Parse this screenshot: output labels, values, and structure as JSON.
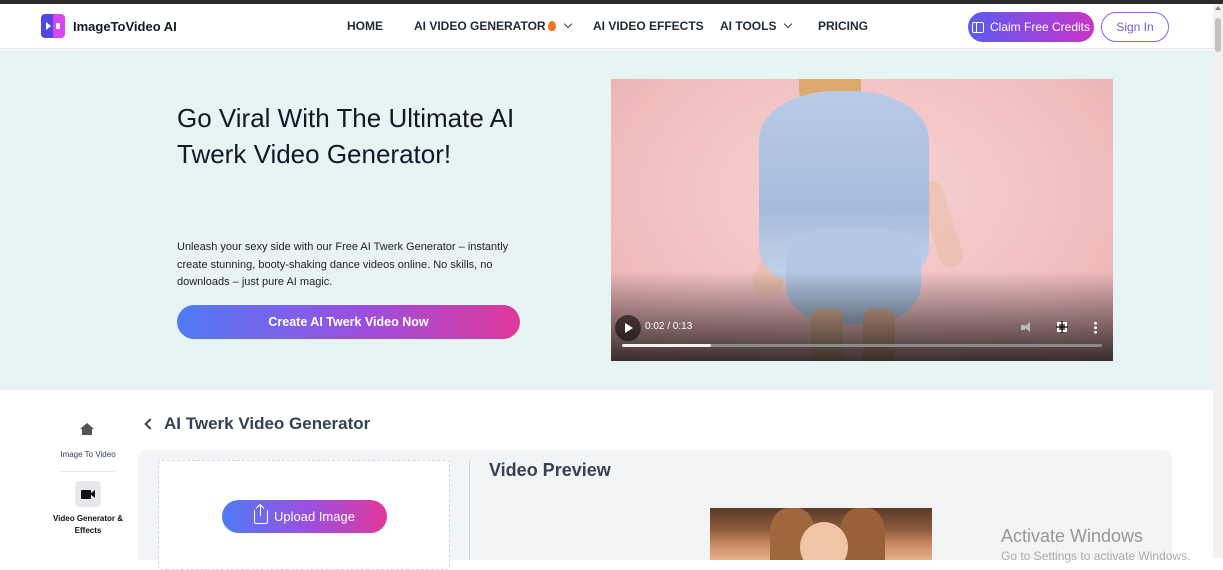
{
  "header": {
    "brand": "ImageToVideo AI",
    "nav": [
      {
        "label": "HOME"
      },
      {
        "label": "AI VIDEO GENERATOR"
      },
      {
        "label": "AI VIDEO EFFECTS"
      },
      {
        "label": "AI TOOLS"
      },
      {
        "label": "PRICING"
      }
    ],
    "claim_label": "Claim Free Credits",
    "signin_label": "Sign In"
  },
  "hero": {
    "title": "Go Viral With The Ultimate AI Twerk Video Generator!",
    "description": "Unleash your sexy side with our Free AI Twerk Generator – instantly create stunning, booty-shaking dance videos online. No skills, no downloads – just pure AI magic.",
    "cta_label": "Create AI Twerk Video Now",
    "video": {
      "time": "0:02 / 0:13",
      "progress": 0.185
    }
  },
  "sidebar": {
    "items": [
      {
        "label": "Image To Video",
        "icon": "home-icon"
      },
      {
        "label": "Video Generator & Effects",
        "icon": "video-camera-icon"
      }
    ]
  },
  "tool": {
    "breadcrumb": "AI Twerk Video Generator",
    "upload_label": "Upload Image",
    "preview_title": "Video Preview"
  },
  "watermark": {
    "title": "Activate Windows",
    "subtitle": "Go to Settings to activate Windows."
  },
  "colors": {
    "accent_gradient_start": "#4f7bf5",
    "accent_gradient_end": "#e0399a",
    "hero_bg": "#e8f4f4"
  }
}
